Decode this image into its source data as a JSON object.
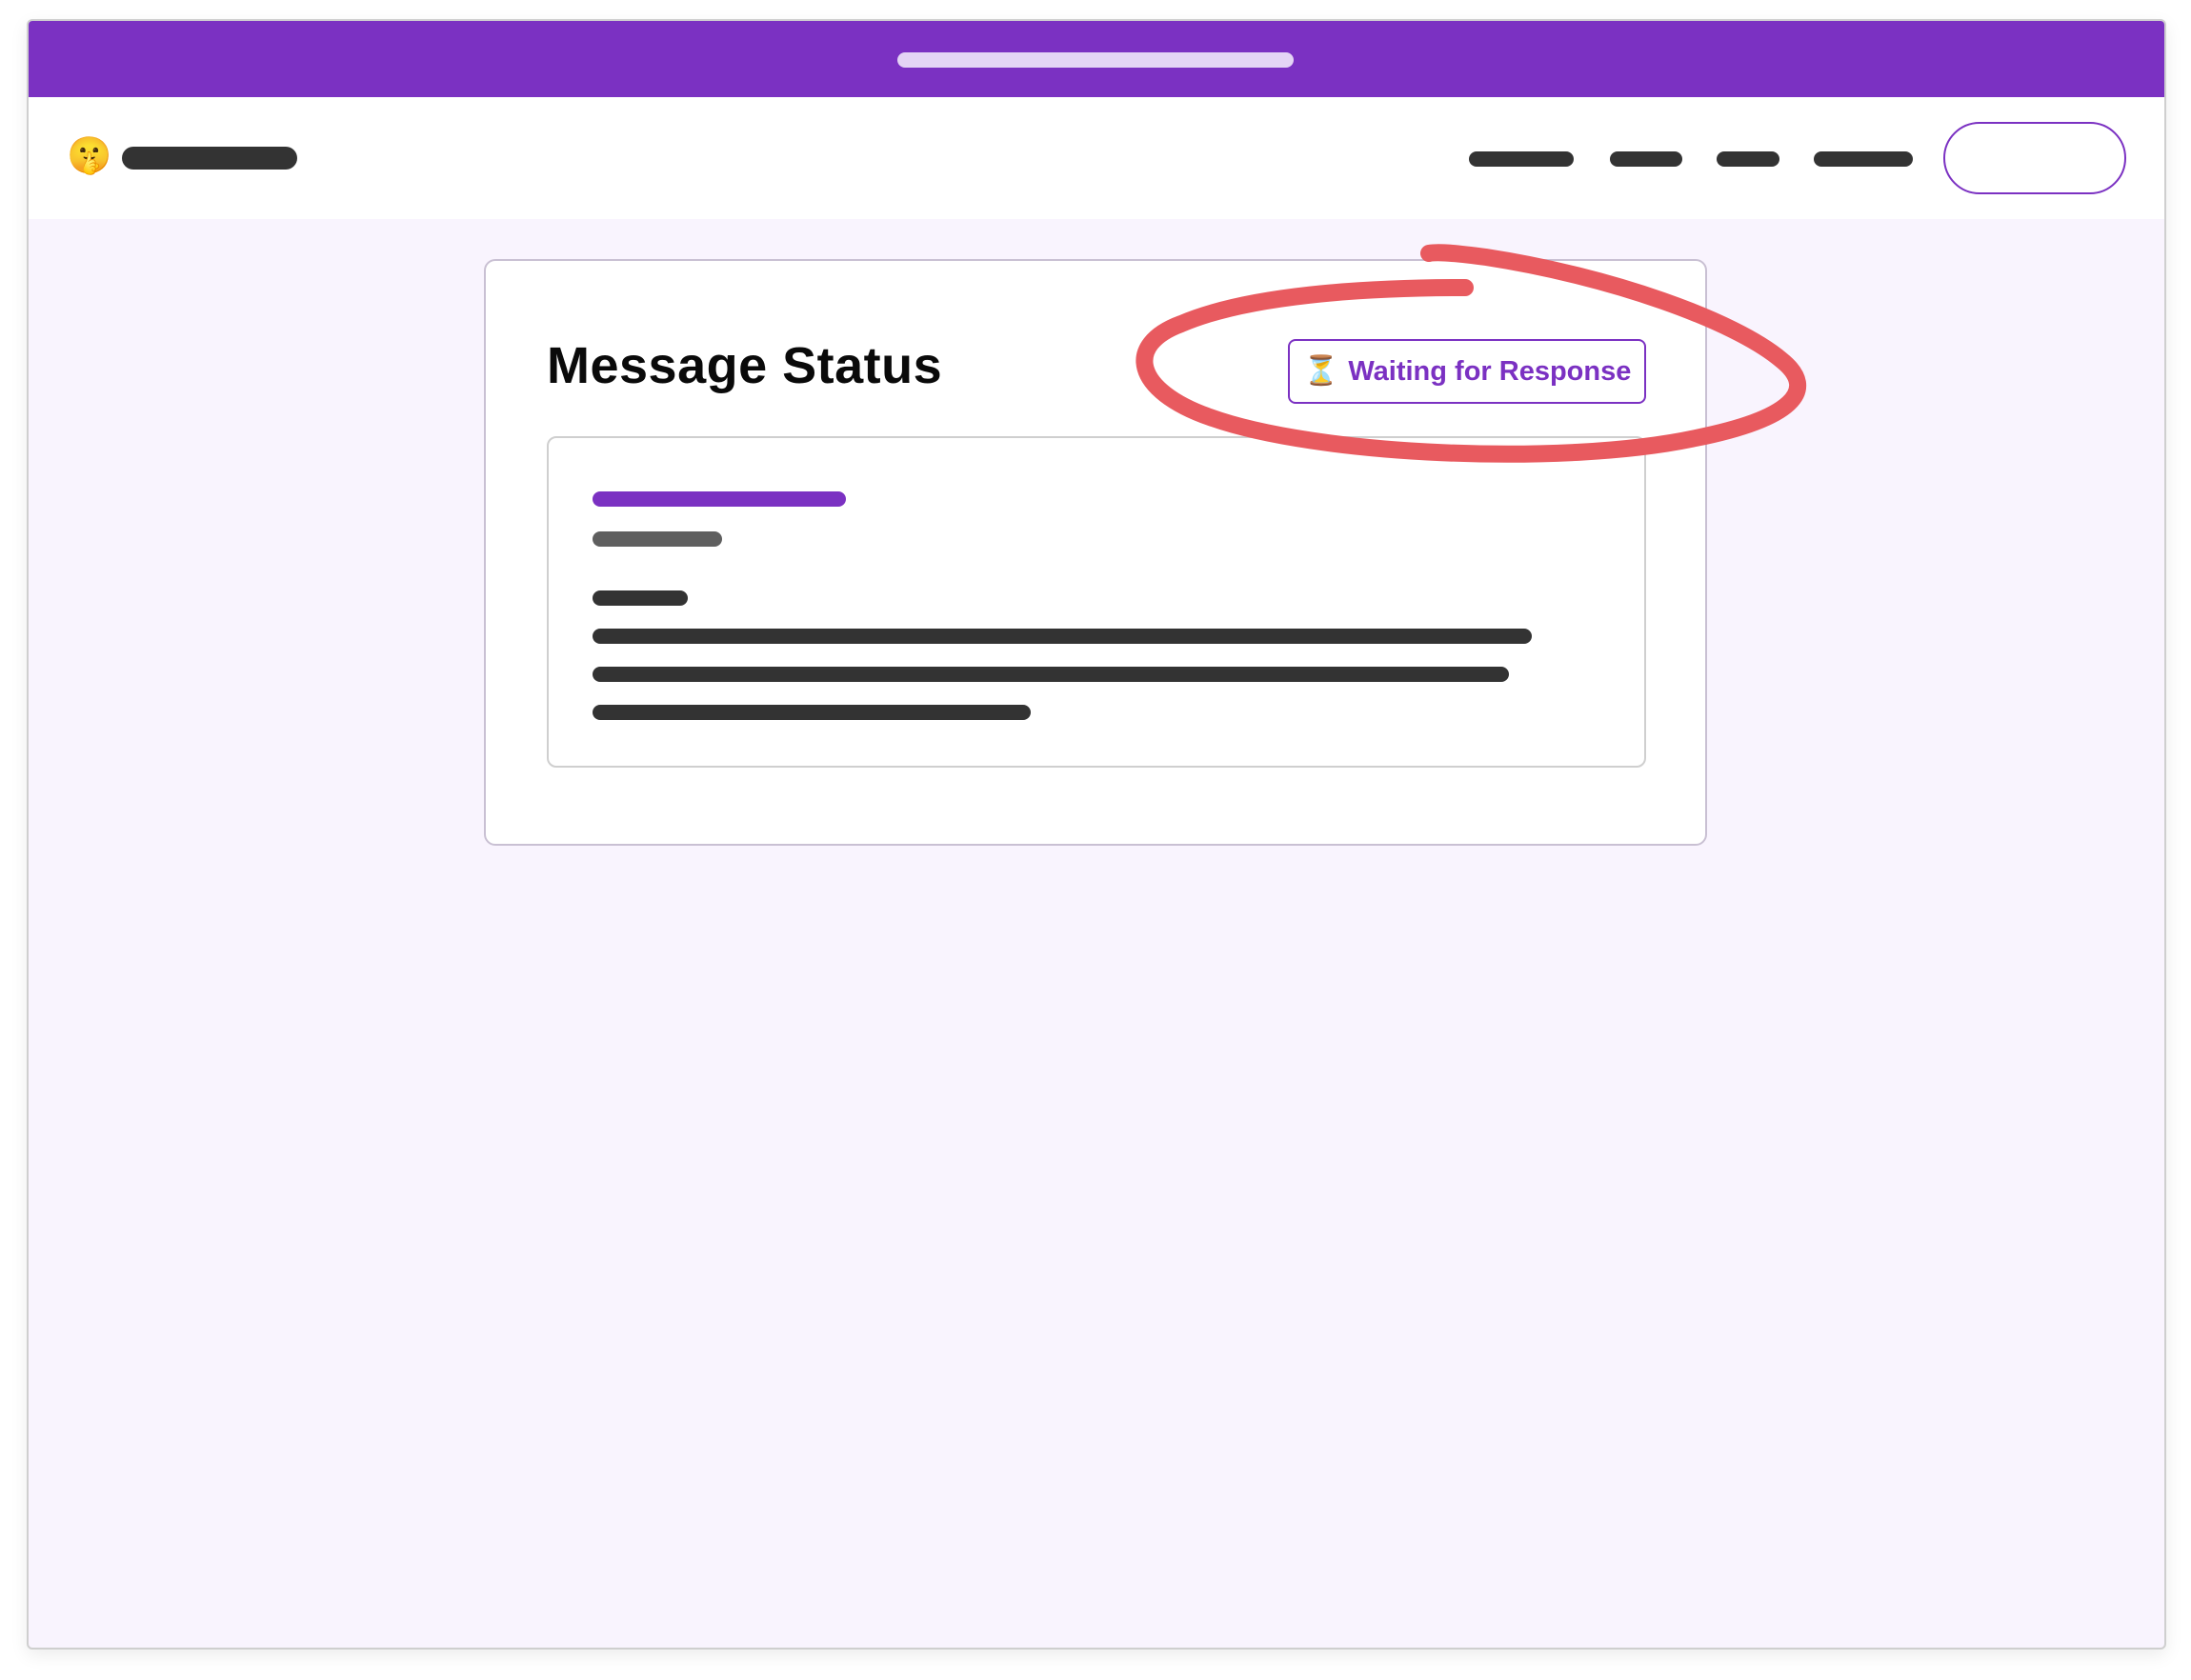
{
  "header": {
    "logo_icon": "shushing-face-emoji"
  },
  "card": {
    "title": "Message Status",
    "status": {
      "icon": "⏳",
      "icon_name": "hourglass-icon",
      "label": "Waiting for Response"
    }
  },
  "colors": {
    "brand": "#7b31c2",
    "page_bg": "#f9f4fe",
    "annotation": "#e85a5f"
  }
}
